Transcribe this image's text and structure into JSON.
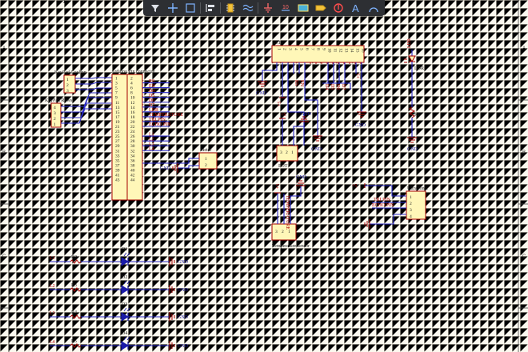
{
  "toolbar": {
    "tools": [
      {
        "name": "filter-icon",
        "tip": "Filter"
      },
      {
        "name": "crosshair-icon",
        "tip": "Select"
      },
      {
        "name": "rectangle-select-icon",
        "tip": "Area Select"
      },
      {
        "name": "align-icon",
        "tip": "Align"
      },
      {
        "name": "part-icon",
        "tip": "Place Part"
      },
      {
        "name": "wire-icon",
        "tip": "Place Wire"
      },
      {
        "name": "power-port-icon",
        "tip": "Place Power Port"
      },
      {
        "name": "net-label-icon",
        "tip": "Place Net Label"
      },
      {
        "name": "harness-icon",
        "tip": "Place Harness"
      },
      {
        "name": "port-icon",
        "tip": "Place Port"
      },
      {
        "name": "no-erc-icon",
        "tip": "Place No ERC"
      },
      {
        "name": "text-icon",
        "tip": "Place Text"
      },
      {
        "name": "arc-icon",
        "tip": "Place Arc"
      }
    ]
  },
  "frame": {
    "zones_left": [
      "A",
      "B",
      "C"
    ],
    "zones_right": [
      "A",
      "B",
      "C"
    ],
    "zone_top": "1"
  },
  "keypad_columns": {
    "title": "KeyPad Coulmn",
    "pins": [
      "1",
      "2",
      "3"
    ]
  },
  "keypad_rows": {
    "title": "KeyPad Rows",
    "pins": [
      "4",
      "3",
      "2",
      "1"
    ]
  },
  "arduino": {
    "title": "Arduino Pin connector",
    "left_pins": [
      "1",
      "3",
      "5",
      "7",
      "9",
      "11",
      "13",
      "15",
      "17",
      "19",
      "21",
      "23",
      "25",
      "27",
      "29",
      "31",
      "33",
      "35",
      "37",
      "39",
      "41",
      "43"
    ],
    "right_pins": [
      "2",
      "4",
      "6",
      "8",
      "10",
      "12",
      "14",
      "16",
      "18",
      "20",
      "22",
      "24",
      "26",
      "28",
      "30",
      "32",
      "34",
      "36",
      "38",
      "40",
      "42",
      "44"
    ],
    "nets": [
      "RS",
      "EN",
      "D4",
      "D5",
      "D6",
      "D7",
      "LDR",
      "TEMPERATURE",
      "TRI PIN",
      "ECHO PIN",
      "L1",
      "L2",
      "L3",
      "L4"
    ]
  },
  "meter": {
    "title": "Meter",
    "pins": [
      "1",
      "2"
    ],
    "gnd": "GND"
  },
  "lcd": {
    "title": "LCD",
    "pins": [
      "1",
      "2",
      "3",
      "4",
      "5",
      "6",
      "7",
      "8",
      "9",
      "10",
      "11",
      "12",
      "13",
      "14",
      "15",
      "16"
    ],
    "nets": [
      "RS",
      "EN",
      "D4",
      "D5",
      "D6",
      "D7"
    ],
    "gnd": "GND",
    "vcc": "+5"
  },
  "pot": {
    "title": "POT",
    "pins": [
      "3",
      "2",
      "1"
    ],
    "vcc": "+5",
    "gnd_top": "GND",
    "gnd_bottom": "GND"
  },
  "ldr": {
    "label_top": "LDR",
    "designator": "LDR",
    "resistor": "R1",
    "gnd": "GND"
  },
  "temp_sensor": {
    "title": "Temperature sensor",
    "net": "TEMPERATURE",
    "vcc": "+5",
    "gnd": "GND",
    "pins": [
      "3",
      "2",
      "1"
    ]
  },
  "ultrasonic": {
    "title": "UltraSonic",
    "vcc": "+5",
    "nets": [
      "TRI PIN",
      "ECHO PIN"
    ],
    "pins": [
      "1",
      "2",
      "3",
      "4"
    ],
    "gnd": "GND"
  },
  "leds": [
    {
      "net": "L1",
      "resistor": "R2",
      "diode": "D1",
      "gnd": "GND"
    },
    {
      "net": "L2",
      "resistor": "R3",
      "diode": "D2",
      "gnd": "GND"
    },
    {
      "net": "L3",
      "resistor": "R4",
      "diode": "D3",
      "gnd": "GND"
    },
    {
      "net": "L4",
      "resistor": "R5",
      "diode": "D4",
      "gnd": "GND"
    }
  ]
}
